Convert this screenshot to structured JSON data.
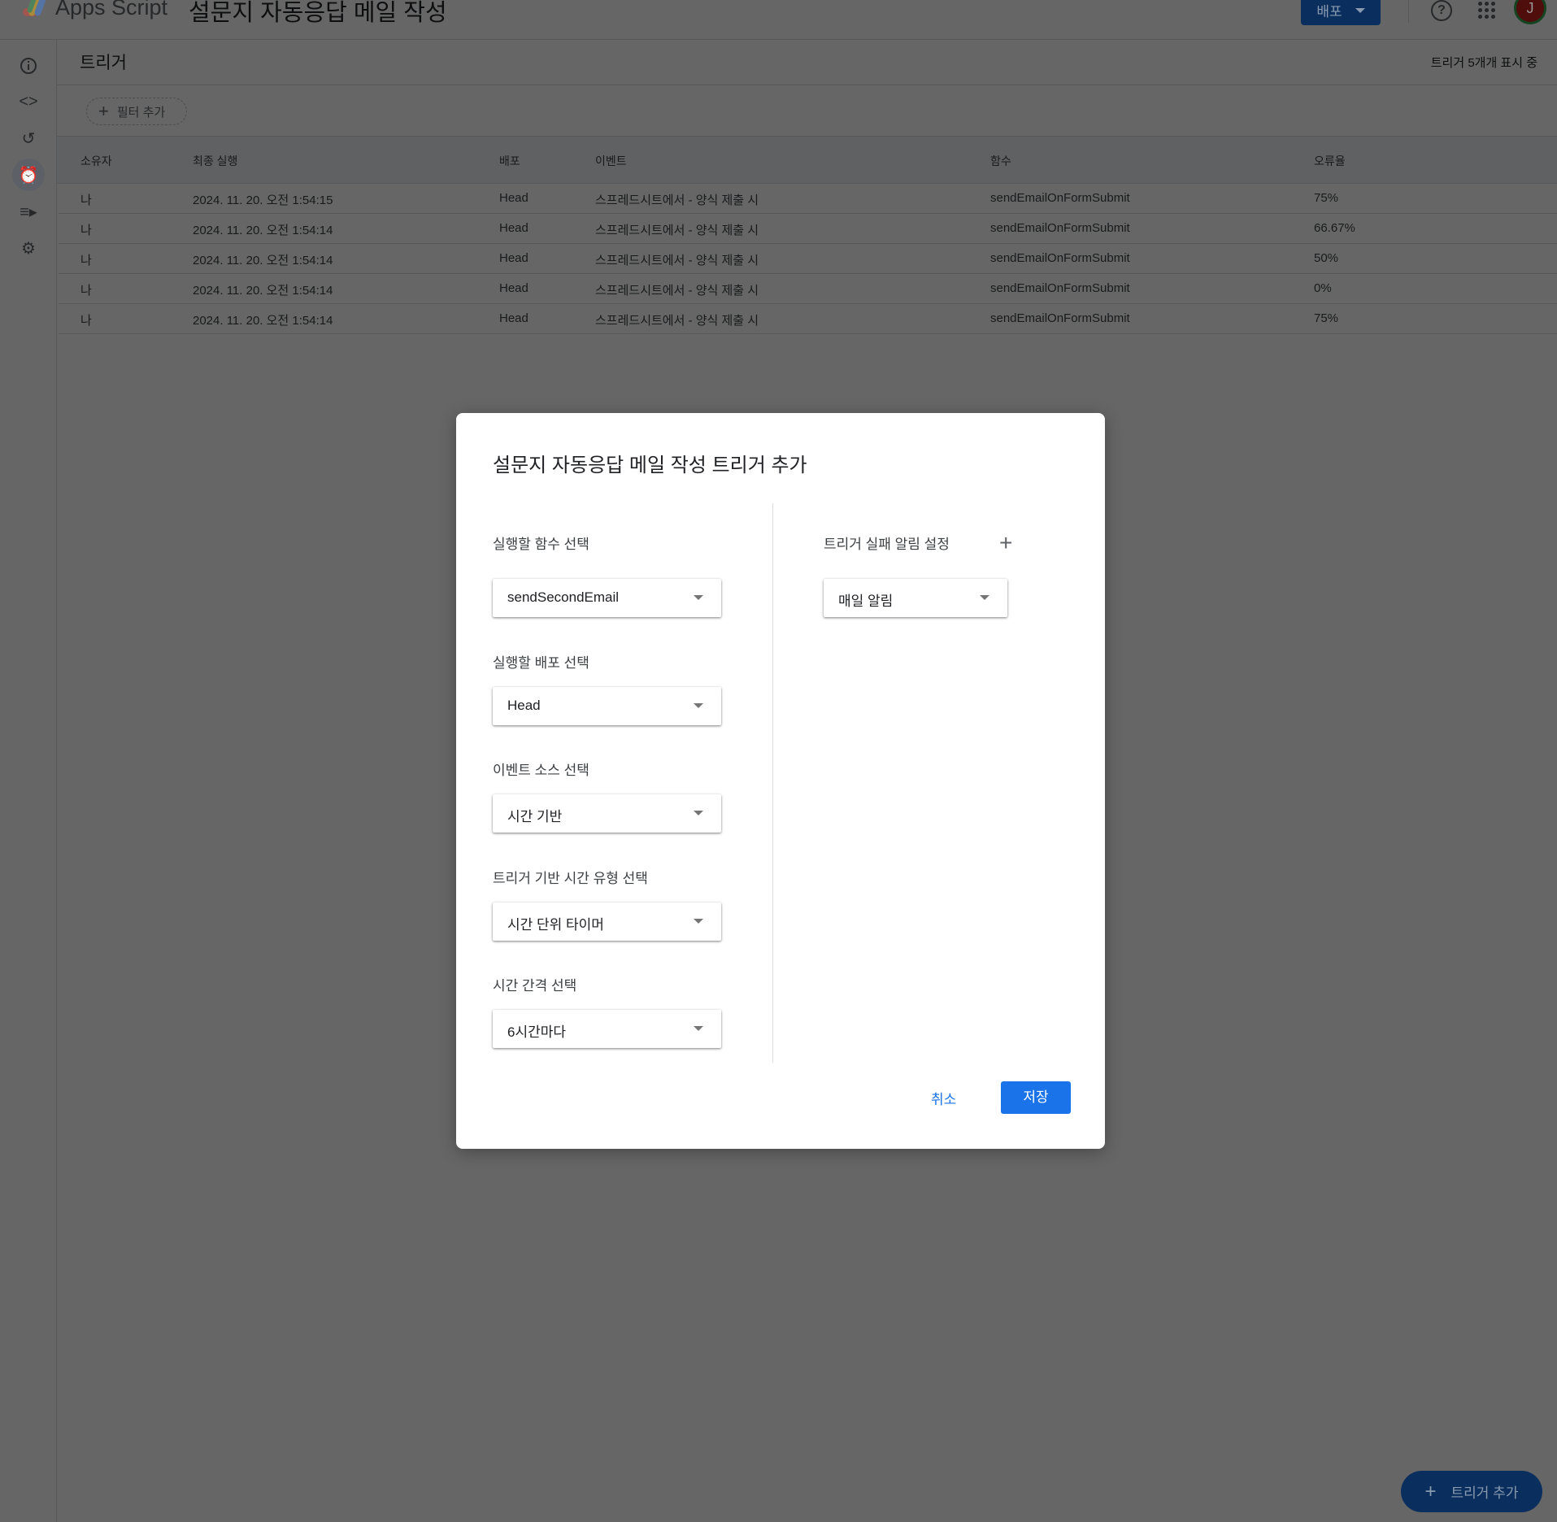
{
  "header": {
    "app_name": "Apps Script",
    "project_title": "설문지 자동응답 메일 작성",
    "deploy_label": "배포",
    "help_icon": "?",
    "avatar_letter": "J"
  },
  "page": {
    "title": "트리거",
    "count_text": "트리거 5개개 표시 중",
    "filter_label": "필터 추가"
  },
  "table": {
    "headers": [
      "소유자",
      "최종 실행",
      "배포",
      "이벤트",
      "함수",
      "오류율"
    ],
    "rows": [
      [
        "나",
        "2024. 11. 20. 오전 1:54:15",
        "Head",
        "스프레드시트에서 - 양식 제출 시",
        "sendEmailOnFormSubmit",
        "75%"
      ],
      [
        "나",
        "2024. 11. 20. 오전 1:54:14",
        "Head",
        "스프레드시트에서 - 양식 제출 시",
        "sendEmailOnFormSubmit",
        "66.67%"
      ],
      [
        "나",
        "2024. 11. 20. 오전 1:54:14",
        "Head",
        "스프레드시트에서 - 양식 제출 시",
        "sendEmailOnFormSubmit",
        "50%"
      ],
      [
        "나",
        "2024. 11. 20. 오전 1:54:14",
        "Head",
        "스프레드시트에서 - 양식 제출 시",
        "sendEmailOnFormSubmit",
        "0%"
      ],
      [
        "나",
        "2024. 11. 20. 오전 1:54:14",
        "Head",
        "스프레드시트에서 - 양식 제출 시",
        "sendEmailOnFormSubmit",
        "75%"
      ]
    ]
  },
  "modal": {
    "title": "설문지 자동응답 메일 작성 트리거 추가",
    "fields": [
      {
        "label": "실행할 함수 선택",
        "value": "sendSecondEmail"
      },
      {
        "label": "실행할 배포 선택",
        "value": "Head"
      },
      {
        "label": "이벤트 소스 선택",
        "value": "시간 기반"
      },
      {
        "label": "트리거 기반 시간 유형 선택",
        "value": "시간 단위 타이머"
      },
      {
        "label": "시간 간격 선택",
        "value": "6시간마다"
      }
    ],
    "notify_label": "트리거 실패 알림 설정",
    "notify_value": "매일 알림",
    "cancel": "취소",
    "save": "저장"
  },
  "fab": {
    "label": "트리거 추가"
  },
  "colors": {
    "accent": "#1a73e8"
  }
}
